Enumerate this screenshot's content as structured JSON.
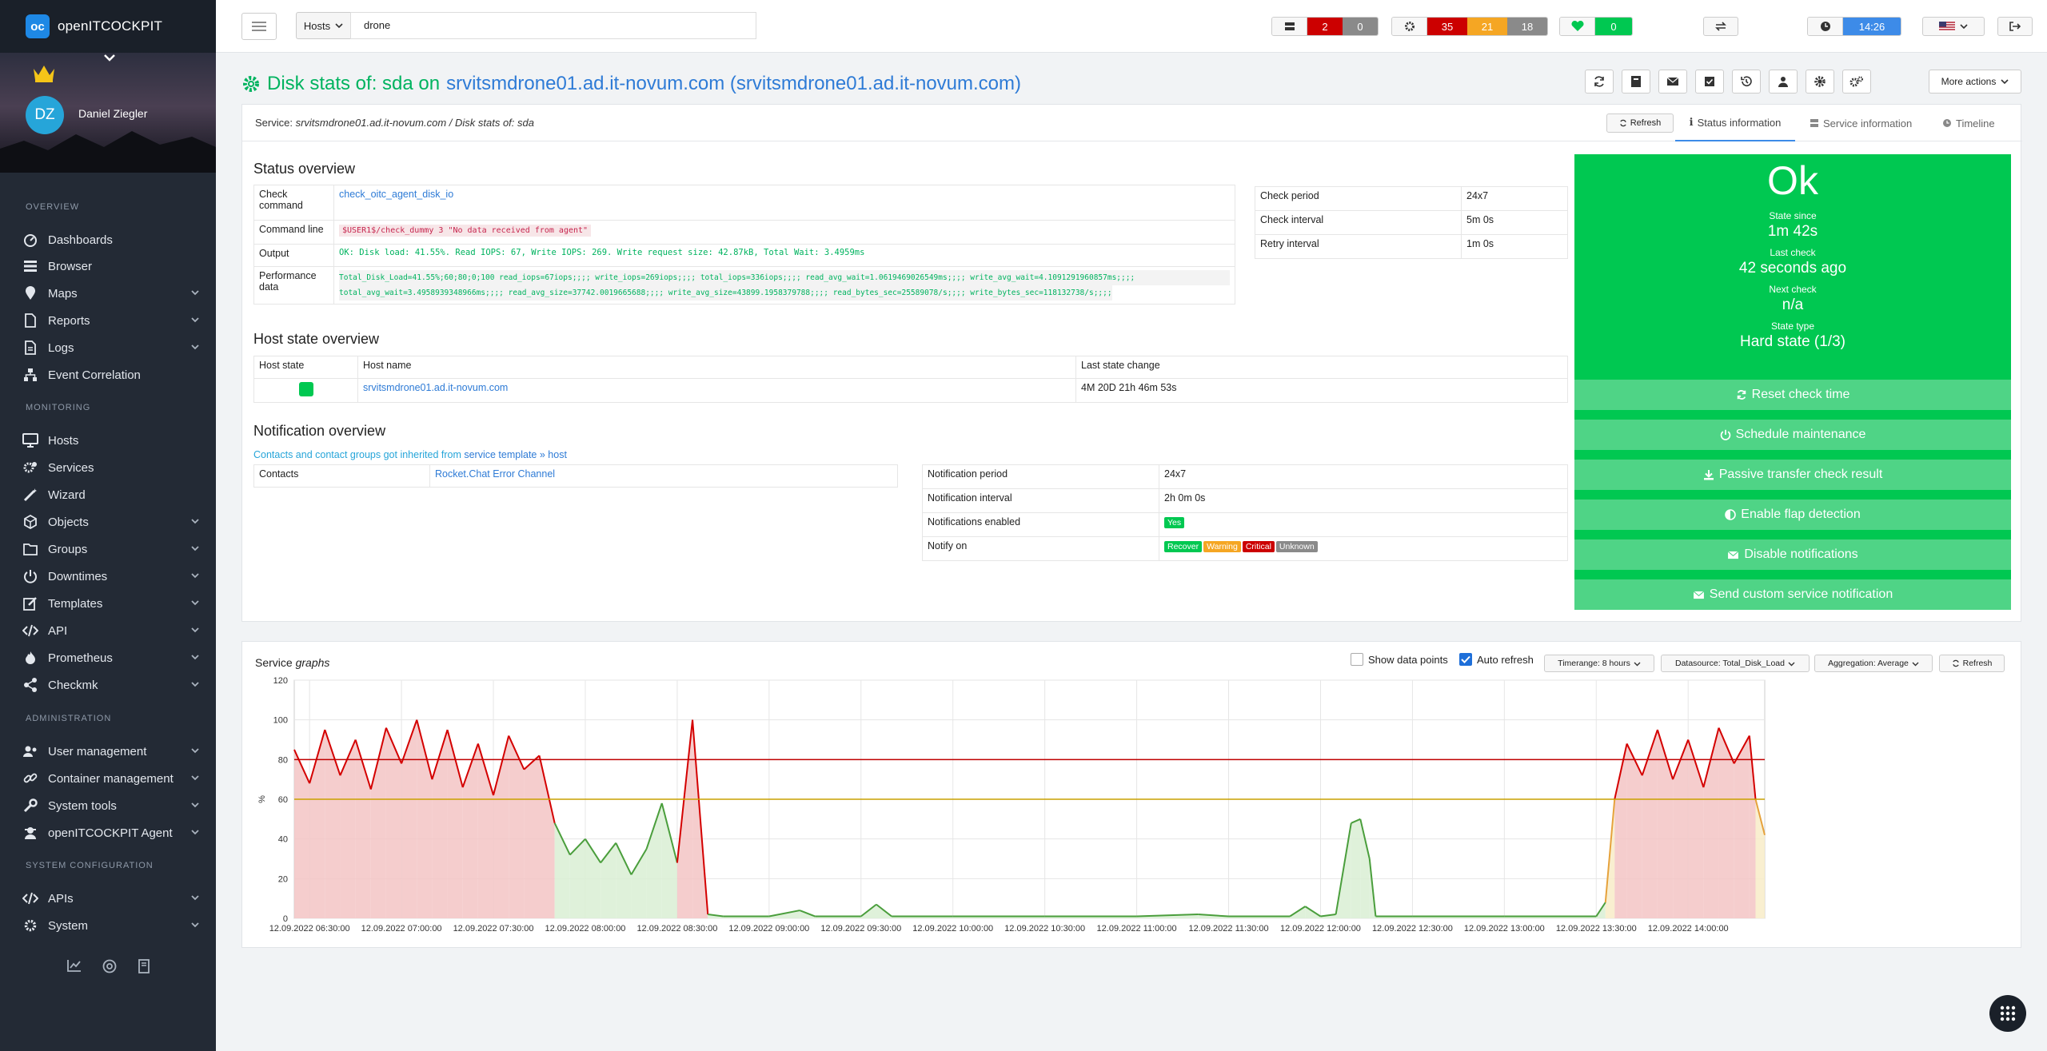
{
  "app": {
    "brand": "openITCOCKPIT"
  },
  "user": {
    "initials": "DZ",
    "name": "Daniel Ziegler"
  },
  "sidebar": {
    "sections": [
      {
        "title": "Overview",
        "items": [
          {
            "label": "Dashboards",
            "icon": "dashboard-icon",
            "arrow": false
          },
          {
            "label": "Browser",
            "icon": "list-icon",
            "arrow": false
          },
          {
            "label": "Maps",
            "icon": "map-marker-icon",
            "arrow": true
          },
          {
            "label": "Reports",
            "icon": "file-icon",
            "arrow": true
          },
          {
            "label": "Logs",
            "icon": "file-lines-icon",
            "arrow": true
          },
          {
            "label": "Event Correlation",
            "icon": "sitemap-icon",
            "arrow": false
          }
        ]
      },
      {
        "title": "Monitoring",
        "items": [
          {
            "label": "Hosts",
            "icon": "desktop-icon",
            "arrow": false
          },
          {
            "label": "Services",
            "icon": "cogs-icon",
            "arrow": false
          },
          {
            "label": "Wizard",
            "icon": "wand-icon",
            "arrow": false
          },
          {
            "label": "Objects",
            "icon": "cubes-icon",
            "arrow": true
          },
          {
            "label": "Groups",
            "icon": "folder-icon",
            "arrow": true
          },
          {
            "label": "Downtimes",
            "icon": "power-icon",
            "arrow": true
          },
          {
            "label": "Templates",
            "icon": "edit-icon",
            "arrow": true
          },
          {
            "label": "API",
            "icon": "code-icon",
            "arrow": true
          },
          {
            "label": "Prometheus",
            "icon": "fire-icon",
            "arrow": true
          },
          {
            "label": "Checkmk",
            "icon": "share-icon",
            "arrow": true
          }
        ]
      },
      {
        "title": "Administration",
        "items": [
          {
            "label": "User management",
            "icon": "users-icon",
            "arrow": true
          },
          {
            "label": "Container management",
            "icon": "link-icon",
            "arrow": true
          },
          {
            "label": "System tools",
            "icon": "wrench-icon",
            "arrow": true
          },
          {
            "label": "openITCOCKPIT Agent",
            "icon": "user-secret-icon",
            "arrow": true
          }
        ]
      },
      {
        "title": "System configuration",
        "items": [
          {
            "label": "APIs",
            "icon": "code-icon",
            "arrow": true
          },
          {
            "label": "System",
            "icon": "gear-icon",
            "arrow": true
          }
        ]
      }
    ]
  },
  "topbar": {
    "host_select": "Hosts",
    "search_value": "drone",
    "host_counts": {
      "red": "2",
      "grey": "0"
    },
    "service_counts": {
      "red": "35",
      "orange": "21",
      "grey": "18"
    },
    "heartbeat_count": "0",
    "time": "14:26"
  },
  "page": {
    "title_prefix": "Disk stats of: sda on",
    "title_host": "srvitsmdrone01.ad.it-novum.com (srvitsmdrone01.ad.it-novum.com)",
    "more_actions": "More actions"
  },
  "card": {
    "service_label": "Service:",
    "service_path": "srvitsmdrone01.ad.it-novum.com / Disk stats of:  sda",
    "refresh": "Refresh",
    "tabs": [
      "Status information",
      "Service information",
      "Timeline"
    ]
  },
  "status_overview": {
    "heading": "Status overview",
    "check_command_label": "Check command",
    "check_command": "check_oitc_agent_disk_io",
    "command_line_label": "Command line",
    "command_line": "$USER1$/check_dummy 3 \"No data received from agent\"",
    "output_label": "Output",
    "output": "OK: Disk load: 41.55%. Read IOPS: 67, Write IOPS: 269. Write request size: 42.87kB, Total Wait: 3.4959ms",
    "perf_label": "Performance data",
    "perf_line1": "Total_Disk_Load=41.55%;60;80;0;100 read_iops=67iops;;;; write_iops=269iops;;;; total_iops=336iops;;;; read_avg_wait=1.0619469026549ms;;;; write_avg_wait=4.1091291960857ms;;;;",
    "perf_line2": "total_avg_wait=3.4958939348966ms;;;; read_avg_size=37742.0019665688;;;; write_avg_size=43899.1958379788;;;; read_bytes_sec=25589078/s;;;; write_bytes_sec=118132738/s;;;;",
    "check_period_label": "Check period",
    "check_period": "24x7",
    "check_interval_label": "Check interval",
    "check_interval": "5m 0s",
    "retry_interval_label": "Retry interval",
    "retry_interval": "1m 0s"
  },
  "status_box": {
    "state": "Ok",
    "state_since_label": "State since",
    "state_since": "1m 42s",
    "last_check_label": "Last check",
    "last_check": "42 seconds ago",
    "next_check_label": "Next check",
    "next_check": "n/a",
    "state_type_label": "State type",
    "state_type": "Hard state (1/3)",
    "buttons": [
      "Reset check time",
      "Schedule maintenance",
      "Passive transfer check result",
      "Enable flap detection",
      "Disable notifications",
      "Send custom service notification"
    ],
    "color": "#00c851"
  },
  "host_state": {
    "heading": "Host state overview",
    "headers": [
      "Host state",
      "Host name",
      "Last state change"
    ],
    "host_name": "srvitsmdrone01.ad.it-novum.com",
    "last_change": "4M 20D 21h 46m 53s"
  },
  "notification": {
    "heading": "Notification overview",
    "inherit_text": "Contacts and contact groups got inherited from",
    "inherit_from": "service template",
    "inherit_to": "host",
    "contacts_label": "Contacts",
    "contacts": "Rocket.Chat Error Channel",
    "period_label": "Notification period",
    "period": "24x7",
    "interval_label": "Notification interval",
    "interval": "2h 0m 0s",
    "enabled_label": "Notifications enabled",
    "enabled": "Yes",
    "notify_on_label": "Notify on",
    "notify_on": [
      "Recover",
      "Warning",
      "Critical",
      "Unknown"
    ]
  },
  "graph": {
    "title_prefix": "Service",
    "title_suffix": "graphs",
    "show_points": "Show data points",
    "auto_refresh": "Auto refresh",
    "timerange": "Timerange: 8 hours",
    "datasource": "Datasource: Total_Disk_Load",
    "aggregation": "Aggregation: Average",
    "refresh": "Refresh"
  },
  "chart_data": {
    "type": "area",
    "ylabel": "%",
    "ylim": [
      0,
      120
    ],
    "y_ticks": [
      0,
      20,
      40,
      60,
      80,
      100,
      120
    ],
    "x_tick_labels": [
      "12.09.2022 06:30:00",
      "12.09.2022 07:00:00",
      "12.09.2022 07:30:00",
      "12.09.2022 08:00:00",
      "12.09.2022 08:30:00",
      "12.09.2022 09:00:00",
      "12.09.2022 09:30:00",
      "12.09.2022 10:00:00",
      "12.09.2022 10:30:00",
      "12.09.2022 11:00:00",
      "12.09.2022 11:30:00",
      "12.09.2022 12:00:00",
      "12.09.2022 12:30:00",
      "12.09.2022 13:00:00",
      "12.09.2022 13:30:00",
      "12.09.2022 14:00:00"
    ],
    "thresholds": {
      "warning": 60,
      "critical": 80
    },
    "colors": {
      "ok": "#4a9e3c",
      "warning": "#e6a23c",
      "critical": "#d40000",
      "warning_line": "#c9a000",
      "critical_line": "#c00000"
    },
    "x_range": [
      "12.09.2022 06:25:00",
      "12.09.2022 14:25:00"
    ],
    "series": [
      {
        "values": [
          [
            "06:25",
            85
          ],
          [
            "06:30",
            68
          ],
          [
            "06:35",
            95
          ],
          [
            "06:40",
            72
          ],
          [
            "06:45",
            90
          ],
          [
            "06:50",
            65
          ],
          [
            "06:55",
            96
          ],
          [
            "07:00",
            78
          ],
          [
            "07:05",
            100
          ],
          [
            "07:10",
            70
          ],
          [
            "07:15",
            95
          ],
          [
            "07:20",
            66
          ],
          [
            "07:25",
            88
          ],
          [
            "07:30",
            62
          ],
          [
            "07:35",
            92
          ],
          [
            "07:40",
            75
          ],
          [
            "07:45",
            82
          ],
          [
            "07:50",
            48
          ],
          [
            "07:55",
            32
          ],
          [
            "08:00",
            40
          ],
          [
            "08:05",
            28
          ],
          [
            "08:10",
            38
          ],
          [
            "08:15",
            22
          ],
          [
            "08:20",
            35
          ],
          [
            "08:25",
            58
          ],
          [
            "08:30",
            28
          ],
          [
            "08:35",
            100
          ],
          [
            "08:40",
            2
          ],
          [
            "08:45",
            1
          ],
          [
            "09:00",
            1
          ],
          [
            "09:10",
            4
          ],
          [
            "09:15",
            1
          ],
          [
            "09:30",
            1
          ],
          [
            "09:35",
            7
          ],
          [
            "09:40",
            1
          ],
          [
            "10:00",
            1
          ],
          [
            "10:30",
            1
          ],
          [
            "11:00",
            1
          ],
          [
            "11:20",
            2
          ],
          [
            "11:30",
            1
          ],
          [
            "11:50",
            1
          ],
          [
            "11:55",
            6
          ],
          [
            "12:00",
            1
          ],
          [
            "12:05",
            2
          ],
          [
            "12:10",
            48
          ],
          [
            "12:13",
            50
          ],
          [
            "12:16",
            30
          ],
          [
            "12:18",
            1
          ],
          [
            "12:30",
            1
          ],
          [
            "13:00",
            1
          ],
          [
            "13:30",
            1
          ],
          [
            "13:33",
            8
          ],
          [
            "13:36",
            60
          ],
          [
            "13:40",
            88
          ],
          [
            "13:45",
            72
          ],
          [
            "13:50",
            95
          ],
          [
            "13:55",
            70
          ],
          [
            "14:00",
            90
          ],
          [
            "14:05",
            66
          ],
          [
            "14:10",
            96
          ],
          [
            "14:15",
            78
          ],
          [
            "14:20",
            92
          ],
          [
            "14:22",
            60
          ],
          [
            "14:25",
            42
          ]
        ]
      }
    ]
  }
}
